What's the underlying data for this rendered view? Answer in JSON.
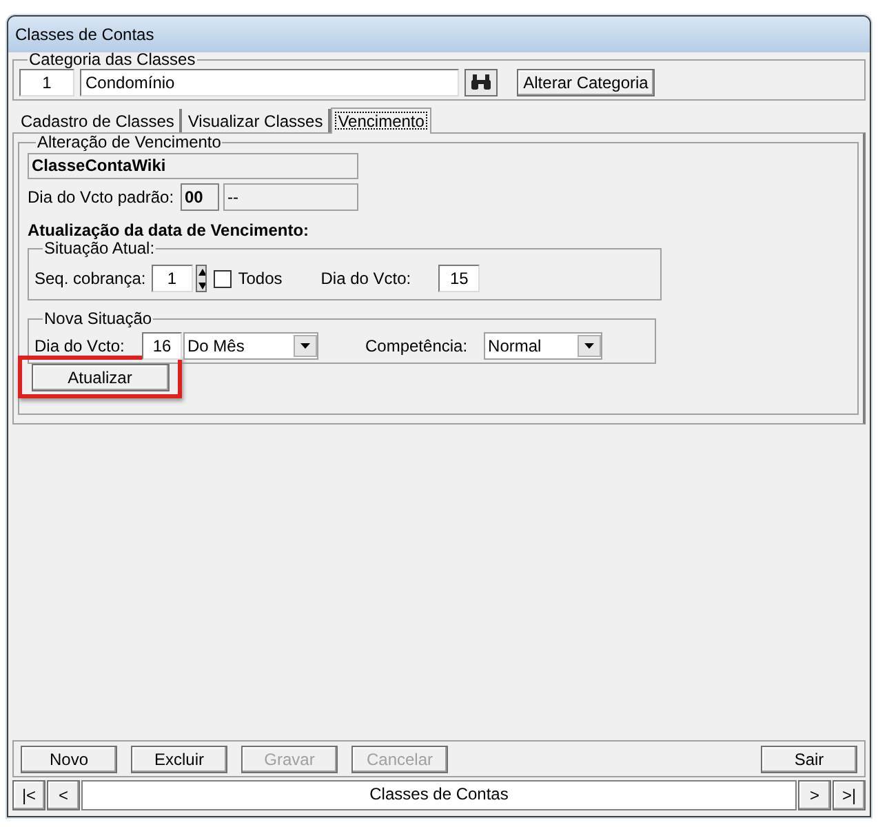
{
  "window": {
    "title": "Classes de Contas"
  },
  "category": {
    "legend": "Categoria das Classes",
    "code": "1",
    "name": "Condomínio",
    "change_button": "Alterar Categoria"
  },
  "tabs": [
    {
      "label": "Cadastro de Classes",
      "selected": false
    },
    {
      "label": "Visualizar Classes",
      "selected": false
    },
    {
      "label": "Vencimento",
      "selected": true
    }
  ],
  "due_change": {
    "legend": "Alteração de Vencimento",
    "class_name": "ClasseContaWiki",
    "default_day_label": "Dia do Vcto padrão:",
    "default_day": "00",
    "default_day_desc": "--",
    "section_title": "Atualização da data de Vencimento:",
    "current": {
      "legend": "Situação Atual:",
      "seq_label": "Seq. cobrança:",
      "seq": "1",
      "all_label": "Todos",
      "all_checked": false,
      "day_label": "Dia do Vcto:",
      "day": "15"
    },
    "new": {
      "legend": "Nova Situação",
      "day_label": "Dia do Vcto:",
      "day": "16",
      "period": "Do Mês",
      "competence_label": "Competência:",
      "competence": "Normal"
    },
    "update_button": {
      "label": "Atualizar",
      "highlighted": true
    }
  },
  "actions": [
    {
      "label": "Novo",
      "disabled": false
    },
    {
      "label": "Excluir",
      "disabled": false
    },
    {
      "label": "Gravar",
      "disabled": true
    },
    {
      "label": "Cancelar",
      "disabled": true
    }
  ],
  "exit_button": {
    "label": "Sair",
    "disabled": false
  },
  "navigator": {
    "first": "|<",
    "prev": "<",
    "caption": "Classes de Contas",
    "next": ">",
    "last": ">|"
  }
}
